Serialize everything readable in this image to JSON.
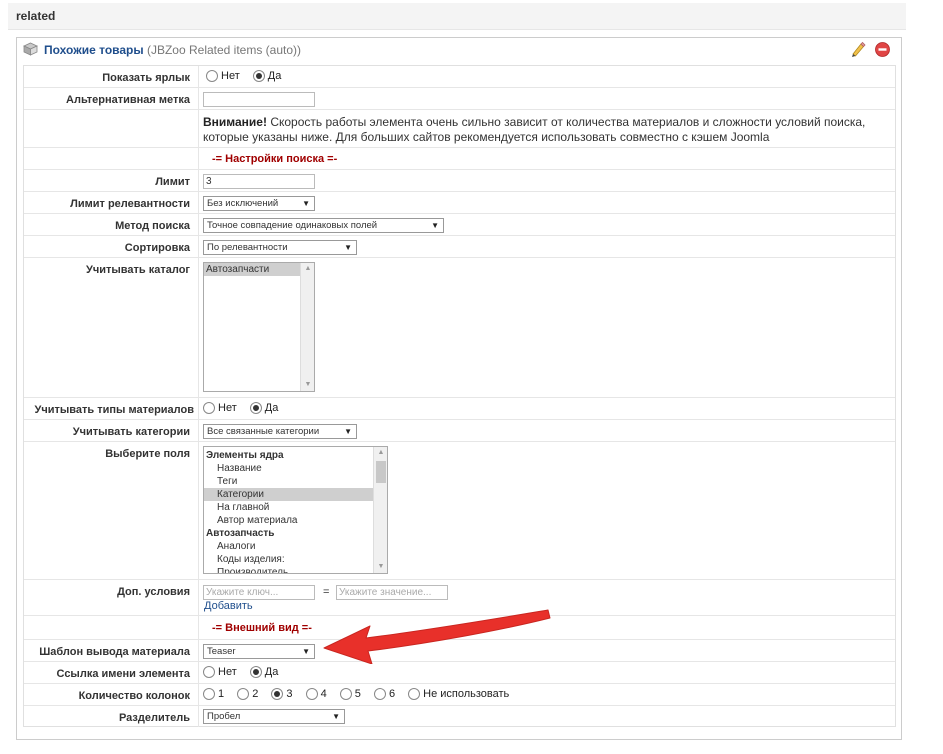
{
  "section": {
    "title": "related"
  },
  "panel": {
    "title": "Похожие товары",
    "subtitle": "(JBZoo Related items (auto))"
  },
  "rows": {
    "show_label": {
      "label": "Показать ярлык",
      "options": [
        "Нет",
        "Да"
      ],
      "selected": "Да"
    },
    "alt_label": {
      "label": "Альтернативная метка",
      "value": ""
    },
    "notice": {
      "strong": "Внимание!",
      "text": " Скорость работы элемента очень сильно зависит от количества материалов и сложности условий поиска, которые указаны ниже. Для больших сайтов рекомендуется использовать совместно с кэшем Joomla"
    },
    "search_settings": {
      "title": "-= Настройки поиска =-"
    },
    "limit": {
      "label": "Лимит",
      "value": "3"
    },
    "relevance_limit": {
      "label": "Лимит релевантности",
      "value": "Без исключений"
    },
    "search_method": {
      "label": "Метод поиска",
      "value": "Точное совпадение одинаковых полей"
    },
    "sorting": {
      "label": "Сортировка",
      "value": "По релевантности"
    },
    "catalog": {
      "label": "Учитывать каталог",
      "items": [
        "Автозапчасти"
      ]
    },
    "types": {
      "label": "Учитывать типы материалов",
      "options": [
        "Нет",
        "Да"
      ],
      "selected": "Да"
    },
    "categories": {
      "label": "Учитывать категории",
      "value": "Все связанные категории"
    },
    "fields": {
      "label": "Выберите поля",
      "groups": [
        {
          "name": "Элементы ядра",
          "items": [
            "Название",
            "Теги",
            "Категории",
            "На главной",
            "Автор материала"
          ]
        },
        {
          "name": "Автозапчасть",
          "items": [
            "Аналоги",
            "Коды изделия:",
            "Производитель"
          ]
        }
      ],
      "selected": "Категории"
    },
    "extra_conditions": {
      "label": "Доп. условия",
      "key_placeholder": "Укажите ключ...",
      "equals": "=",
      "value_placeholder": "Укажите значение...",
      "add_link": "Добавить"
    },
    "appearance": {
      "title": "-= Внешний вид =-"
    },
    "template": {
      "label": "Шаблон вывода материала",
      "value": "Teaser"
    },
    "name_link": {
      "label": "Ссылка имени элемента",
      "options": [
        "Нет",
        "Да"
      ],
      "selected": "Да"
    },
    "columns": {
      "label": "Количество колонок",
      "options": [
        "1",
        "2",
        "3",
        "4",
        "5",
        "6",
        "Не использовать"
      ],
      "selected": "3"
    },
    "separator": {
      "label": "Разделитель",
      "value": "Пробел"
    }
  },
  "colors": {
    "link": "#1f4e8c",
    "section_red": "#a00000",
    "arrow": "#e8302a"
  },
  "icons": {
    "panel": "cube-icon",
    "edit": "pencil-icon",
    "delete": "delete-icon"
  }
}
